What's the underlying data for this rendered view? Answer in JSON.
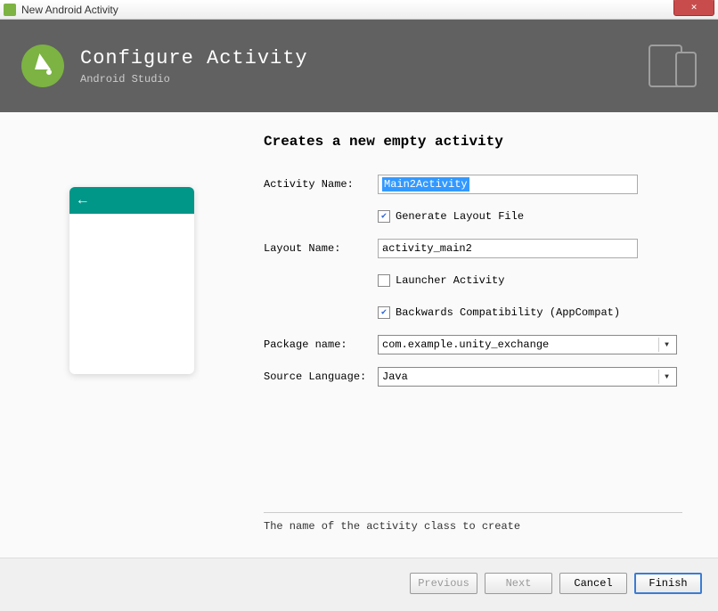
{
  "window": {
    "title": "New Android Activity"
  },
  "header": {
    "title": "Configure Activity",
    "subtitle": "Android Studio"
  },
  "form": {
    "heading": "Creates a new empty activity",
    "activity_name_label": "Activity Name:",
    "activity_name_value": "Main2Activity",
    "generate_layout_checked": true,
    "generate_layout_label": "Generate Layout File",
    "layout_name_label": "Layout Name:",
    "layout_name_value": "activity_main2",
    "launcher_checked": false,
    "launcher_label": "Launcher Activity",
    "backwards_checked": true,
    "backwards_label": "Backwards Compatibility (AppCompat)",
    "package_label": "Package name:",
    "package_value": "com.example.unity_exchange",
    "language_label": "Source Language:",
    "language_value": "Java",
    "hint": "The name of the activity class to create"
  },
  "footer": {
    "previous": "Previous",
    "next": "Next",
    "cancel": "Cancel",
    "finish": "Finish"
  }
}
